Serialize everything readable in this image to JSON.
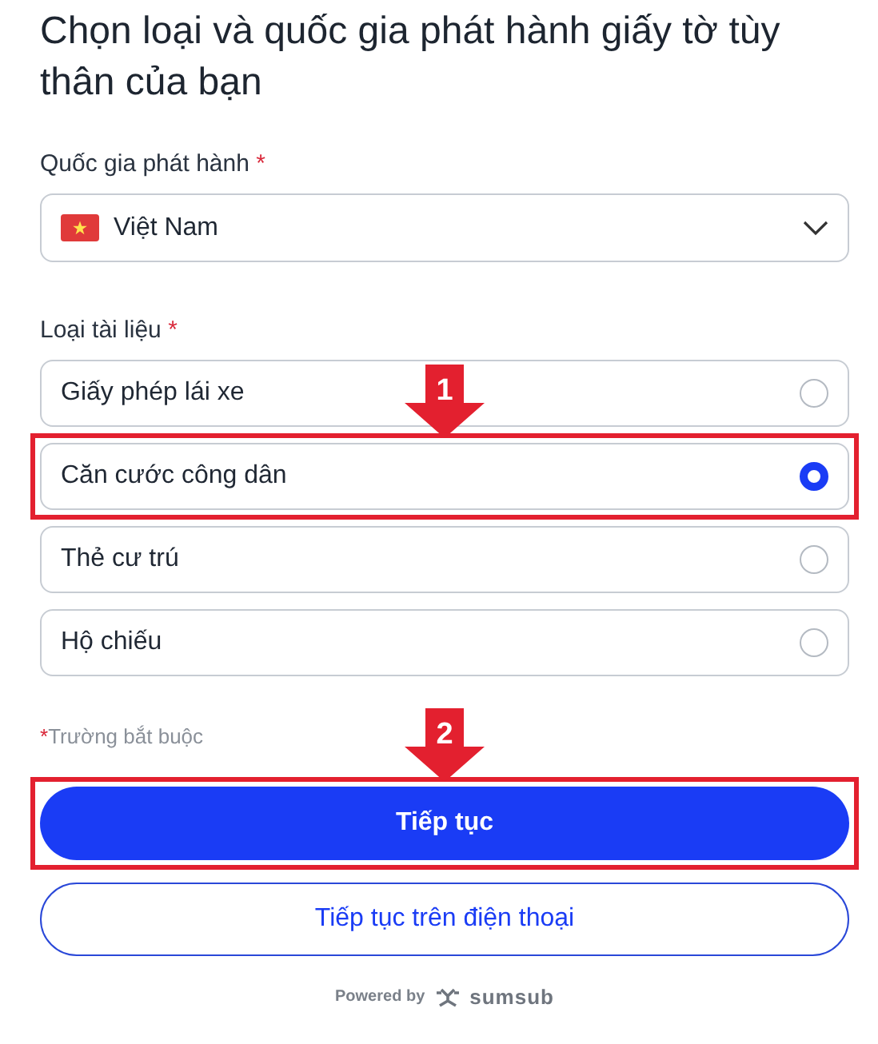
{
  "title": "Chọn loại và quốc gia phát hành giấy tờ tùy thân của bạn",
  "country": {
    "label": "Quốc gia phát hành",
    "required_mark": "*",
    "value": "Việt Nam"
  },
  "document_type": {
    "label": "Loại tài liệu",
    "required_mark": "*",
    "options": [
      {
        "label": "Giấy phép lái xe",
        "selected": false
      },
      {
        "label": "Căn cước công dân",
        "selected": true,
        "callout": "1"
      },
      {
        "label": "Thẻ cư trú",
        "selected": false
      },
      {
        "label": "Hộ chiếu",
        "selected": false
      }
    ]
  },
  "required_note": {
    "mark": "*",
    "text": "Trường bắt buộc"
  },
  "buttons": [
    {
      "label": "Tiếp tục",
      "kind": "primary",
      "callout": "2"
    },
    {
      "label": "Tiếp tục trên điện thoại",
      "kind": "outline"
    }
  ],
  "footer": {
    "powered_by": "Powered by",
    "brand": "sumsub"
  }
}
